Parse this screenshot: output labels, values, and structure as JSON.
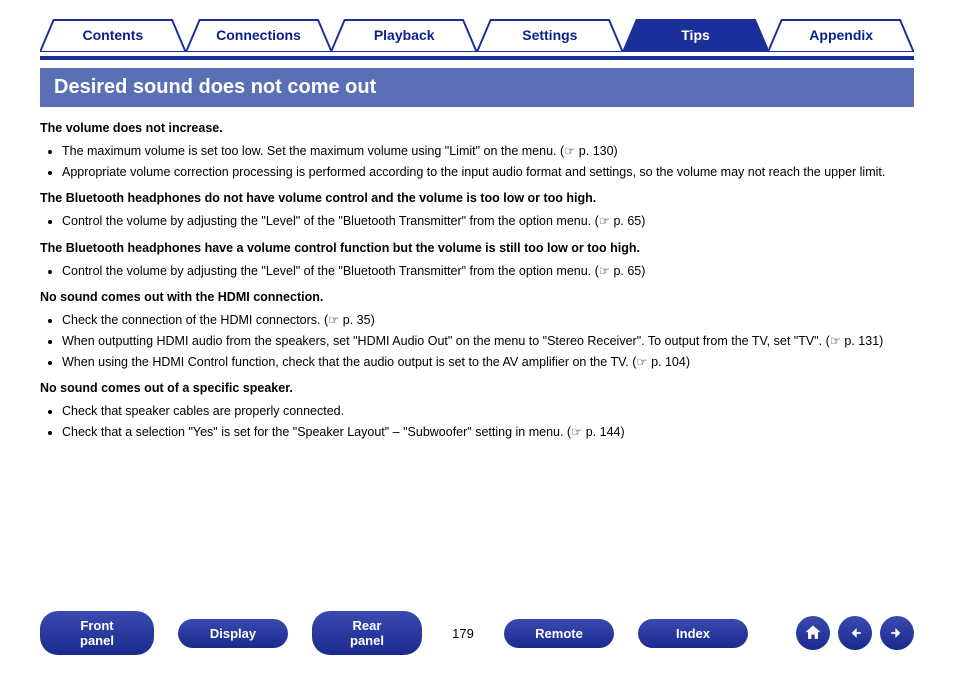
{
  "tabs": [
    {
      "label": "Contents",
      "active": false
    },
    {
      "label": "Connections",
      "active": false
    },
    {
      "label": "Playback",
      "active": false
    },
    {
      "label": "Settings",
      "active": false
    },
    {
      "label": "Tips",
      "active": true
    },
    {
      "label": "Appendix",
      "active": false
    }
  ],
  "title": "Desired sound does not come out",
  "sections": [
    {
      "heading": "The volume does not increase.",
      "items": [
        "The maximum volume is set too low. Set the maximum volume using \"Limit\" on the menu.  (☞ p. 130)",
        "Appropriate volume correction processing is performed according to the input audio format and settings, so the volume may not reach the upper limit."
      ]
    },
    {
      "heading": "The Bluetooth headphones do not have volume control and the volume is too low or too high.",
      "items": [
        "Control the volume by adjusting the \"Level\" of the \"Bluetooth Transmitter\" from the option menu.  (☞ p. 65)"
      ]
    },
    {
      "heading": "The Bluetooth headphones have a volume control function but the volume is still too low or too high.",
      "items": [
        "Control the volume by adjusting the \"Level\" of the \"Bluetooth Transmitter\" from the option menu.  (☞ p. 65)"
      ]
    },
    {
      "heading": "No sound comes out with the HDMI connection.",
      "items": [
        "Check the connection of the HDMI connectors.  (☞ p. 35)",
        "When outputting HDMI audio from the speakers, set \"HDMI Audio Out\" on the menu to \"Stereo Receiver\". To output from the TV, set \"TV\".  (☞ p. 131)",
        "When using the HDMI Control function, check that the audio output is set to the AV amplifier on the TV.  (☞ p. 104)"
      ]
    },
    {
      "heading": "No sound comes out of a specific speaker.",
      "items": [
        "Check that speaker cables are properly connected.",
        "Check that a selection \"Yes\" is set for the \"Speaker Layout\" – \"Subwoofer\" setting in menu.  (☞ p. 144)"
      ]
    }
  ],
  "bottom_buttons": {
    "front": "Front panel",
    "display": "Display",
    "rear": "Rear panel",
    "remote": "Remote",
    "index": "Index"
  },
  "page_number": "179",
  "nav": {
    "home": "home-icon",
    "prev": "arrow-left-icon",
    "next": "arrow-right-icon"
  },
  "colors": {
    "brand": "#1b2f9a",
    "tab_fill_active": "#1b2f9a",
    "title_bar": "#5a6fb6"
  }
}
